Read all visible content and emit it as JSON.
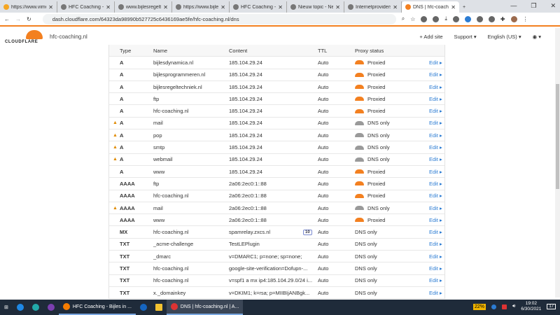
{
  "browser": {
    "tabs": [
      "https://www.vime",
      "HFC Coaching - B",
      "www.bijlesregelte",
      "https://www.bijles",
      "HFC Coaching - B",
      "Nieuw topic - Ne",
      "Internetproviders",
      "DNS | hfc-coachi"
    ],
    "url": "dash.cloudflare.com/64323da98990b527725c6436169ae5fe/hfc-coaching.nl/dns"
  },
  "header": {
    "logo": "CLOUDFLARE",
    "site": "hfc-coaching.nl",
    "add_site": "+ Add site",
    "support": "Support ▾",
    "language": "English (US) ▾",
    "account": "◉ ▾"
  },
  "table": {
    "headers": {
      "type": "Type",
      "name": "Name",
      "content": "Content",
      "ttl": "TTL",
      "proxy": "Proxy status"
    },
    "rows": [
      {
        "warn": "",
        "type": "A",
        "name": "bijlesdynamica.nl",
        "content": "185.104.29.24",
        "ttl": "Auto",
        "proxy": "Proxied",
        "edit": "Edit ▸"
      },
      {
        "warn": "",
        "type": "A",
        "name": "bijlesprogrammeren.nl",
        "content": "185.104.29.24",
        "ttl": "Auto",
        "proxy": "Proxied",
        "edit": "Edit ▸"
      },
      {
        "warn": "",
        "type": "A",
        "name": "bijlesregeltechniek.nl",
        "content": "185.104.29.24",
        "ttl": "Auto",
        "proxy": "Proxied",
        "edit": "Edit ▸"
      },
      {
        "warn": "",
        "type": "A",
        "name": "ftp",
        "content": "185.104.29.24",
        "ttl": "Auto",
        "proxy": "Proxied",
        "edit": "Edit ▸"
      },
      {
        "warn": "",
        "type": "A",
        "name": "hfc-coaching.nl",
        "content": "185.104.29.24",
        "ttl": "Auto",
        "proxy": "Proxied",
        "edit": "Edit ▸"
      },
      {
        "warn": "▲",
        "type": "A",
        "name": "mail",
        "content": "185.104.29.24",
        "ttl": "Auto",
        "proxy": "DNS only",
        "edit": "Edit ▸"
      },
      {
        "warn": "▲",
        "type": "A",
        "name": "pop",
        "content": "185.104.29.24",
        "ttl": "Auto",
        "proxy": "DNS only",
        "edit": "Edit ▸"
      },
      {
        "warn": "▲",
        "type": "A",
        "name": "smtp",
        "content": "185.104.29.24",
        "ttl": "Auto",
        "proxy": "DNS only",
        "edit": "Edit ▸"
      },
      {
        "warn": "▲",
        "type": "A",
        "name": "webmail",
        "content": "185.104.29.24",
        "ttl": "Auto",
        "proxy": "DNS only",
        "edit": "Edit ▸"
      },
      {
        "warn": "",
        "type": "A",
        "name": "www",
        "content": "185.104.29.24",
        "ttl": "Auto",
        "proxy": "Proxied",
        "edit": "Edit ▸"
      },
      {
        "warn": "",
        "type": "AAAA",
        "name": "ftp",
        "content": "2a06:2ec0:1::88",
        "ttl": "Auto",
        "proxy": "Proxied",
        "edit": "Edit ▸"
      },
      {
        "warn": "",
        "type": "AAAA",
        "name": "hfc-coaching.nl",
        "content": "2a06:2ec0:1::88",
        "ttl": "Auto",
        "proxy": "Proxied",
        "edit": "Edit ▸"
      },
      {
        "warn": "▲",
        "type": "AAAA",
        "name": "mail",
        "content": "2a06:2ec0:1::88",
        "ttl": "Auto",
        "proxy": "DNS only",
        "edit": "Edit ▸"
      },
      {
        "warn": "",
        "type": "AAAA",
        "name": "www",
        "content": "2a06:2ec0:1::88",
        "ttl": "Auto",
        "proxy": "Proxied",
        "edit": "Edit ▸"
      },
      {
        "warn": "",
        "type": "MX",
        "name": "hfc-coaching.nl",
        "content": "spamrelay.zxcs.nl",
        "priority": "10",
        "ttl": "Auto",
        "proxy": "DNS only",
        "edit": "Edit ▸",
        "noicon": true
      },
      {
        "warn": "",
        "type": "TXT",
        "name": "_acme-challenge",
        "content": "TestLEPlugin",
        "ttl": "Auto",
        "proxy": "DNS only",
        "edit": "Edit ▸",
        "noicon": true
      },
      {
        "warn": "",
        "type": "TXT",
        "name": "_dmarc",
        "content": "v=DMARC1; p=none; sp=none;",
        "ttl": "Auto",
        "proxy": "DNS only",
        "edit": "Edit ▸",
        "noicon": true
      },
      {
        "warn": "",
        "type": "TXT",
        "name": "hfc-coaching.nl",
        "content": "google-site-verification=Dofupn-...",
        "ttl": "Auto",
        "proxy": "DNS only",
        "edit": "Edit ▸",
        "noicon": true
      },
      {
        "warn": "",
        "type": "TXT",
        "name": "hfc-coaching.nl",
        "content": "v=spf1 a mx ip4:185.104.29.0/24 i...",
        "ttl": "Auto",
        "proxy": "DNS only",
        "edit": "Edit ▸",
        "noicon": true
      },
      {
        "warn": "",
        "type": "TXT",
        "name": "x._domainkey",
        "content": "v=DKIM1; k=rsa; p=MIIBIjANBgk...",
        "ttl": "Auto",
        "proxy": "DNS only",
        "edit": "Edit ▸",
        "noicon": true
      }
    ]
  },
  "taskbar": {
    "firefox": "HFC Coaching - Bijles in ...",
    "chrome": "DNS | hfc-coaching.nl | A...",
    "battery": "22%",
    "time": "19:02",
    "date": "6/30/2021",
    "notifications": "17"
  },
  "colors": {
    "accent": "#f38020",
    "proxied": "#f38020",
    "dns_only": "#9a9a9a",
    "link": "#2c7cd3"
  }
}
